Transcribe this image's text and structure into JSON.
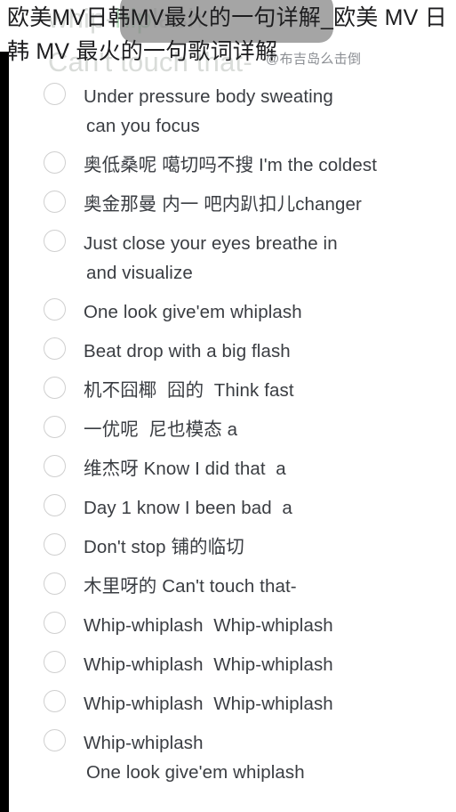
{
  "page": {
    "overlay_title": "欧美MV日韩MV最火的一句详解_欧美 MV 日韩 MV 最火的一句歌词详解",
    "watermark": "@布吉岛么击倒"
  },
  "background_ghost_text": {
    "line1_prefix": "whip-",
    "line1_accent": "hip",
    "line1_suffix": "lash",
    "line2": "Can't touch that-"
  },
  "lyrics": {
    "rows": [
      {
        "text": "Under pressure body sweating",
        "continuation": "can you focus",
        "has_radio": true
      },
      {
        "text": "奥低桑呢 噶切吗不搜 I'm the coldest",
        "continuation": "",
        "has_radio": true
      },
      {
        "text": "奥金那曼 内一 吧内趴扣儿changer",
        "continuation": "",
        "has_radio": true
      },
      {
        "text": "Just close your eyes breathe in",
        "continuation": "and visualize",
        "has_radio": true
      },
      {
        "text": "One look give'em whiplash",
        "continuation": "",
        "has_radio": true
      },
      {
        "text": "Beat drop with a big flash",
        "continuation": "",
        "has_radio": true
      },
      {
        "text": "机不囧椰  囧的  Think fast",
        "continuation": "",
        "has_radio": true
      },
      {
        "text": "一优呢  尼也模态 a",
        "continuation": "",
        "has_radio": true
      },
      {
        "text": "维杰呀 Know I did that  a",
        "continuation": "",
        "has_radio": true
      },
      {
        "text": "Day 1 know I been bad  a",
        "continuation": "",
        "has_radio": true
      },
      {
        "text": "Don't stop 铺的临切",
        "continuation": "",
        "has_radio": true
      },
      {
        "text": "木里呀的 Can't touch that-",
        "continuation": "",
        "has_radio": true
      },
      {
        "text": "Whip-whiplash  Whip-whiplash",
        "continuation": "",
        "has_radio": true
      },
      {
        "text": "Whip-whiplash  Whip-whiplash",
        "continuation": "",
        "has_radio": true
      },
      {
        "text": "Whip-whiplash  Whip-whiplash",
        "continuation": "",
        "has_radio": true
      },
      {
        "text": "Whip-whiplash",
        "continuation": "One look give'em whiplash",
        "has_radio": true
      }
    ]
  },
  "colors": {
    "text": "#3a3d42",
    "title": "#1d1d1f",
    "ghost": "#d9dcd9",
    "ghost_accent": "#bfe0c4",
    "radio_border": "#cfcfcf",
    "backdrop": "rgba(130,130,130,0.72)",
    "stripe": "#000000"
  }
}
